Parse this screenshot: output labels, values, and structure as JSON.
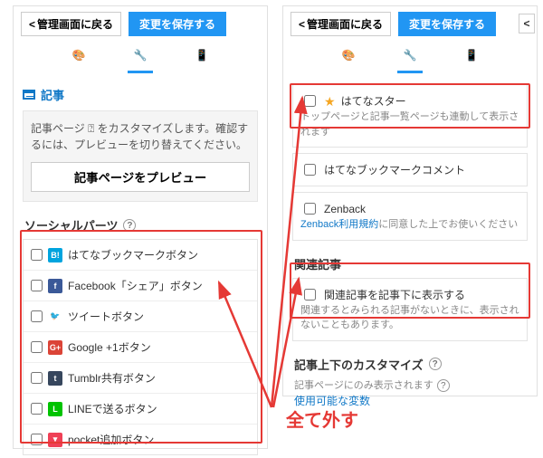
{
  "header": {
    "back_label": "管理画面に戻る",
    "save_label": "変更を保存する"
  },
  "left": {
    "article_heading": "記事",
    "customize_msg": "記事ページ ⍰ をカスタマイズします。確認するには、プレビューを切り替えてください。",
    "preview_btn": "記事ページをプレビュー",
    "social_heading": "ソーシャルパーツ",
    "social_items": [
      {
        "icon": "hb",
        "symbol": "B!",
        "label": "はてなブックマークボタン"
      },
      {
        "icon": "fb",
        "symbol": "f",
        "label": "Facebook「シェア」ボタン"
      },
      {
        "icon": "tw",
        "symbol": "🐦",
        "label": "ツイートボタン"
      },
      {
        "icon": "gp",
        "symbol": "G+",
        "label": "Google +1ボタン"
      },
      {
        "icon": "tb",
        "symbol": "t",
        "label": "Tumblr共有ボタン"
      },
      {
        "icon": "ln",
        "symbol": "L",
        "label": "LINEで送るボタン"
      },
      {
        "icon": "pk",
        "symbol": "▾",
        "label": "pocket追加ボタン"
      }
    ]
  },
  "right": {
    "star_label": "はてなスター",
    "star_note": "トップページと記事一覧ページも連動して表示されます",
    "hb_comment_label": "はてなブックマークコメント",
    "zenback_label": "Zenback",
    "zenback_note_pre": "Zenback利用規約",
    "zenback_note_post": "に同意した上でお使いください",
    "related_heading": "関連記事",
    "related_check_label": "関連記事を記事下に表示する",
    "related_note": "関連するとみられる記事がないときに、表示されないこともあります。",
    "customize_heading": "記事上下のカスタマイズ",
    "customize_note": "記事ページにのみ表示されます",
    "customize_link": "使用可能な変数"
  },
  "annotation": {
    "remove_all": "全て外す"
  }
}
